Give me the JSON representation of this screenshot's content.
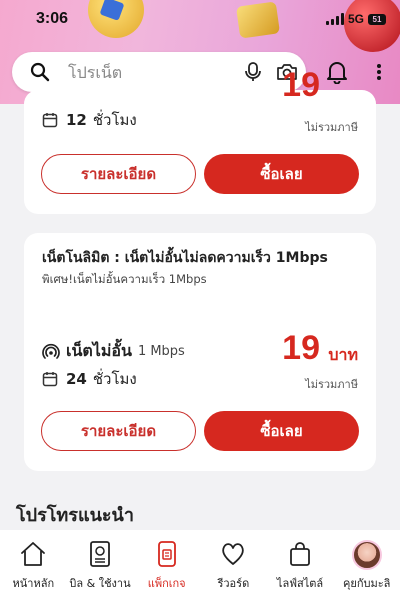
{
  "status": {
    "time": "3:06",
    "network": "5G",
    "battery": "51"
  },
  "search": {
    "placeholder": "โปรเน็ต"
  },
  "card1": {
    "duration_value": "12",
    "duration_unit": "ชั่วโมง",
    "price": "19",
    "tax_note": "ไม่รวมภาษี",
    "details_label": "รายละเอียด",
    "buy_label": "ซื้อเลย"
  },
  "card2": {
    "title": "เน็ตโนลิมิต : เน็ตไม่อั้นไม่ลดความเร็ว 1Mbps",
    "subtitle": "พิเศษ!เน็ตไม่อั้นความเร็ว 1Mbps",
    "speed_label": "เน็ตไม่อั้น",
    "speed_value": "1 Mbps",
    "duration_value": "24",
    "duration_unit": "ชั่วโมง",
    "price": "19",
    "price_unit": "บาท",
    "tax_note": "ไม่รวมภาษี",
    "details_label": "รายละเอียด",
    "buy_label": "ซื้อเลย"
  },
  "section": {
    "title": "โปรโทรแนะนำ"
  },
  "nav": {
    "items": [
      {
        "label": "หน้าหลัก",
        "icon": "home-icon"
      },
      {
        "label": "บิล & ใช้งาน",
        "icon": "bill-icon"
      },
      {
        "label": "แพ็กเกจ",
        "icon": "package-icon",
        "active": true
      },
      {
        "label": "รีวอร์ด",
        "icon": "heart-icon"
      },
      {
        "label": "ไลฟ์สไตล์",
        "icon": "shopping-bag-icon"
      },
      {
        "label": "คุยกับมะลิ",
        "icon": "avatar"
      }
    ]
  },
  "colors": {
    "accent": "#d6281f",
    "header_pink": "#f1b6dc",
    "background": "#f2f2f4"
  }
}
